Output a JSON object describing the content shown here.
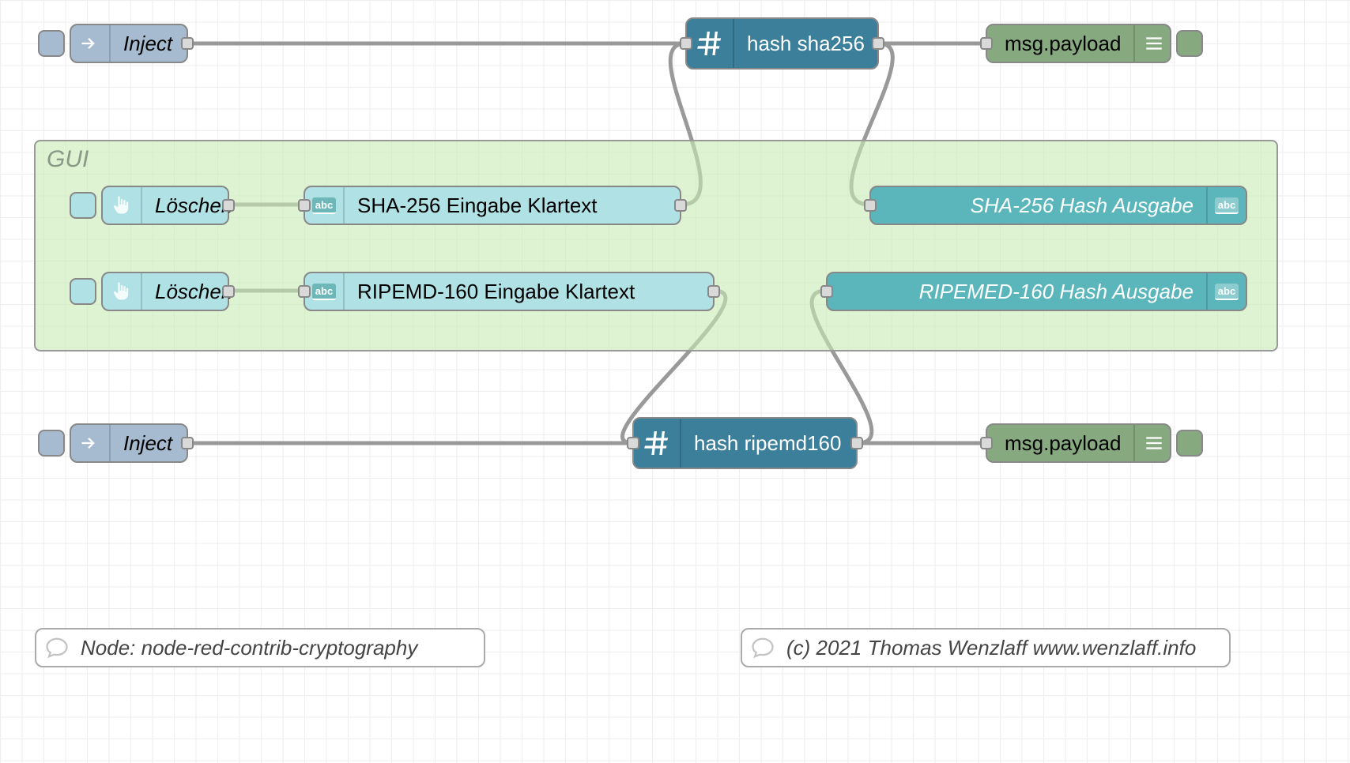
{
  "group": {
    "label": "GUI"
  },
  "nodes": {
    "inject1": {
      "label": "Inject"
    },
    "inject2": {
      "label": "Inject"
    },
    "hash_sha256": {
      "label": "hash sha256"
    },
    "hash_ripemd": {
      "label": "hash ripemd160"
    },
    "debug1": {
      "label": "msg.payload"
    },
    "debug2": {
      "label": "msg.payload"
    },
    "btn_loeschen1": {
      "label": "Löschen"
    },
    "btn_loeschen2": {
      "label": "Löschen"
    },
    "txt_sha_in": {
      "label": "SHA-256 Eingabe Klartext"
    },
    "txt_rip_in": {
      "label": "RIPEMD-160 Eingabe Klartext"
    },
    "txt_sha_out": {
      "label": "SHA-256 Hash Ausgabe"
    },
    "txt_rip_out": {
      "label": "RIPEMED-160 Hash Ausgabe"
    }
  },
  "comments": {
    "left": "Node: node-red-contrib-cryptography",
    "right": "(c) 2021 Thomas Wenzlaff www.wenzlaff.info"
  }
}
